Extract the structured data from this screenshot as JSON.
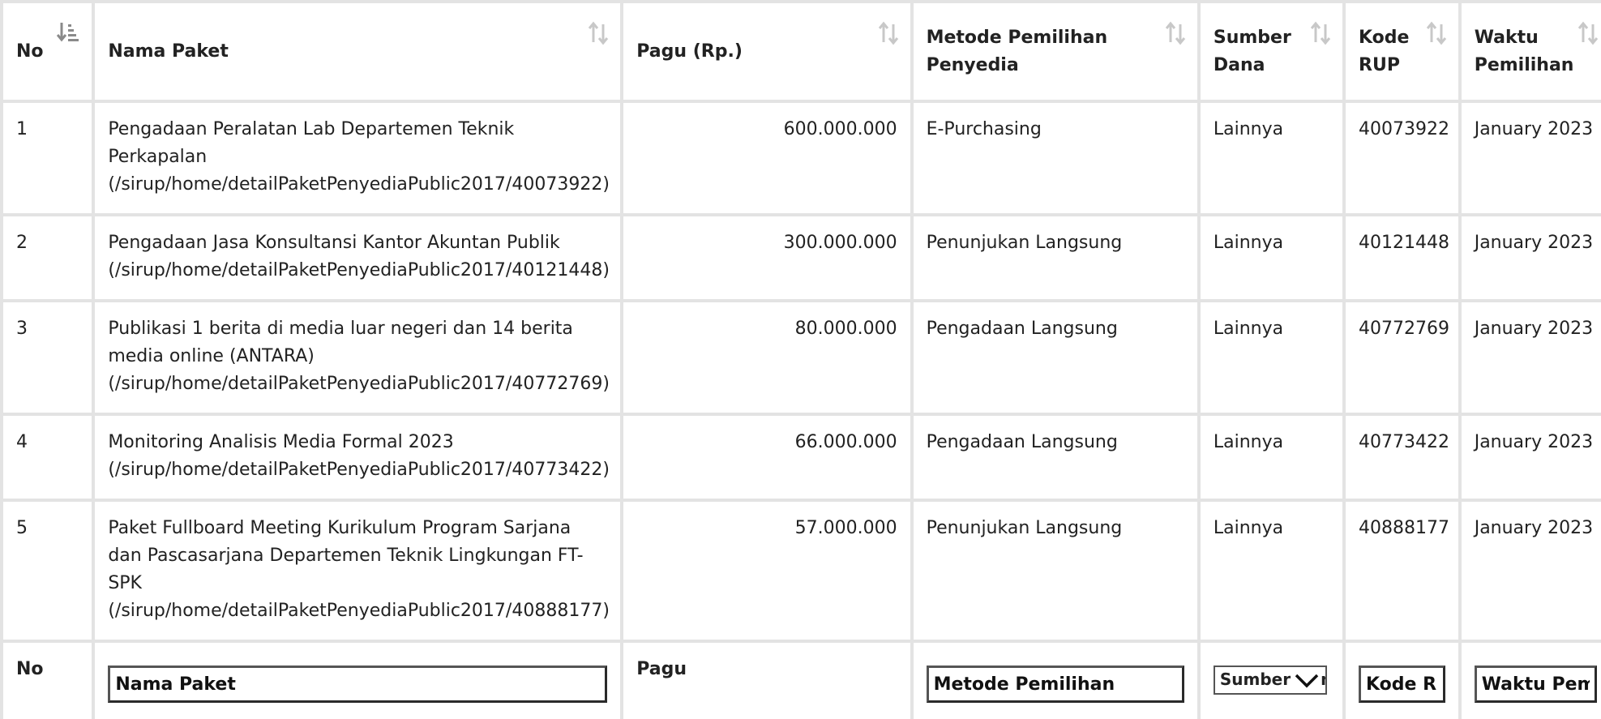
{
  "table": {
    "headers": [
      {
        "label": "No",
        "active_sort": true
      },
      {
        "label": "Nama Paket"
      },
      {
        "label": "Pagu (Rp.)"
      },
      {
        "label": "Metode Pemilihan Penyedia"
      },
      {
        "label": "Sumber Dana"
      },
      {
        "label": "Kode RUP"
      },
      {
        "label": "Waktu Pemilihan"
      }
    ],
    "rows": [
      {
        "no": "1",
        "nama": "Pengadaan Peralatan Lab Departemen Teknik Perkapalan",
        "link": "(/sirup/home/detailPaketPenyediaPublic2017/40073922)",
        "pagu": "600.000.000",
        "metode": "E-Purchasing",
        "sumber": "Lainnya",
        "kode": "40073922",
        "waktu": "January 2023"
      },
      {
        "no": "2",
        "nama": "Pengadaan Jasa Konsultansi Kantor Akuntan Publik",
        "link": "(/sirup/home/detailPaketPenyediaPublic2017/40121448)",
        "pagu": "300.000.000",
        "metode": "Penunjukan Langsung",
        "sumber": "Lainnya",
        "kode": "40121448",
        "waktu": "January 2023"
      },
      {
        "no": "3",
        "nama": "Publikasi 1 berita di media luar negeri dan 14 berita media online (ANTARA)",
        "link": "(/sirup/home/detailPaketPenyediaPublic2017/40772769)",
        "pagu": "80.000.000",
        "metode": "Pengadaan Langsung",
        "sumber": "Lainnya",
        "kode": "40772769",
        "waktu": "January 2023"
      },
      {
        "no": "4",
        "nama": "Monitoring Analisis Media Formal 2023",
        "link": "(/sirup/home/detailPaketPenyediaPublic2017/40773422)",
        "pagu": "66.000.000",
        "metode": "Pengadaan Langsung",
        "sumber": "Lainnya",
        "kode": "40773422",
        "waktu": "January 2023"
      },
      {
        "no": "5",
        "nama": "Paket Fullboard Meeting Kurikulum Program Sarjana dan Pascasarjana Departemen Teknik Lingkungan FT-SPK",
        "link": "(/sirup/home/detailPaketPenyediaPublic2017/40888177)",
        "pagu": "57.000.000",
        "metode": "Penunjukan Langsung",
        "sumber": "Lainnya",
        "kode": "40888177",
        "waktu": "January 2023"
      }
    ],
    "filters": {
      "no_label": "No",
      "nama_placeholder": "Nama Paket",
      "pagu_label": "Pagu",
      "metode_placeholder": "Metode Pemilihan",
      "sumber_selected": "Sumber Dana",
      "kode_placeholder": "Kode RUP",
      "waktu_placeholder": "Waktu Pemilihan"
    }
  }
}
